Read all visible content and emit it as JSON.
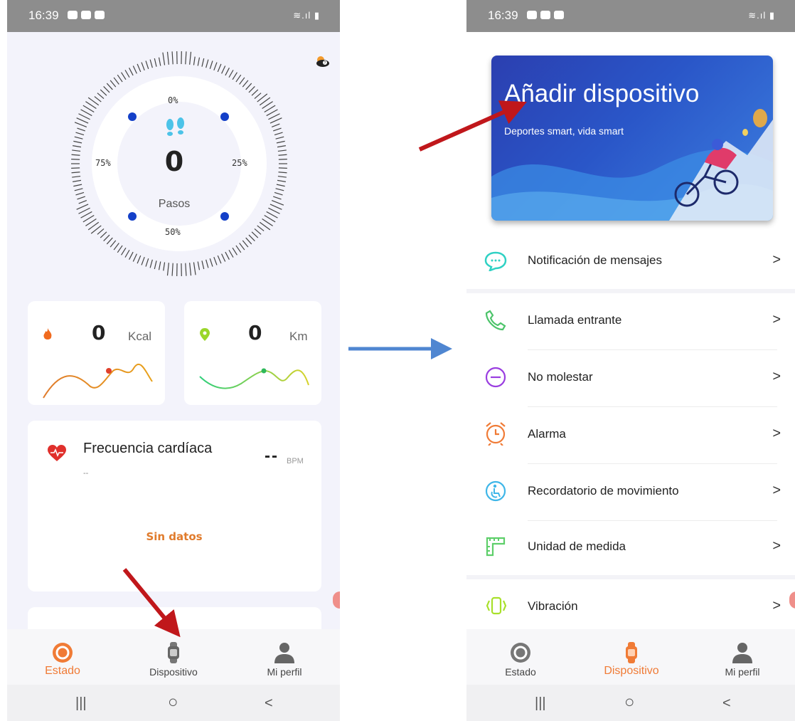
{
  "left_screen": {
    "status": {
      "time": "16:39"
    },
    "steps": {
      "value": "0",
      "label": "Pasos",
      "p0": "0%",
      "p25": "25%",
      "p50": "50%",
      "p75": "75%"
    },
    "calories": {
      "value": "0",
      "unit": "Kcal"
    },
    "distance": {
      "value": "0",
      "unit": "Km"
    },
    "heart_rate": {
      "title": "Frecuencia cardíaca",
      "subtitle": "--",
      "value": "--",
      "unit": "BPM",
      "empty": "Sin datos"
    },
    "tabs": [
      {
        "label": "Estado",
        "icon": "circle-target-icon",
        "active": true
      },
      {
        "label": "Dispositivo",
        "icon": "watch-icon",
        "active": false
      },
      {
        "label": "Mi perfil",
        "icon": "person-icon",
        "active": false
      }
    ],
    "nav": {
      "recents": "|||",
      "home": "○",
      "back": "<"
    }
  },
  "right_screen": {
    "status": {
      "time": "16:39"
    },
    "banner": {
      "title": "Añadir dispositivo",
      "subtitle": "Deportes smart, vida smart"
    },
    "menu": [
      {
        "label": "Notificación de mensajes",
        "icon": "message-bubble-icon"
      },
      {
        "label": "Llamada entrante",
        "icon": "phone-icon"
      },
      {
        "label": "No molestar",
        "icon": "minus-circle-icon"
      },
      {
        "label": "Alarma",
        "icon": "alarm-clock-icon"
      },
      {
        "label": "Recordatorio de movimiento",
        "icon": "accessibility-icon"
      },
      {
        "label": "Unidad de medida",
        "icon": "ruler-icon"
      },
      {
        "label": "Vibración",
        "icon": "vibration-icon"
      }
    ],
    "chevron": ">",
    "tabs": [
      {
        "label": "Estado",
        "icon": "circle-target-icon",
        "active": false
      },
      {
        "label": "Dispositivo",
        "icon": "watch-icon",
        "active": true
      },
      {
        "label": "Mi perfil",
        "icon": "person-icon",
        "active": false
      }
    ],
    "nav": {
      "recents": "|||",
      "home": "○",
      "back": "<"
    }
  },
  "colors": {
    "accent": "#f07b36",
    "arrow_red": "#c0171b",
    "arrow_blue": "#4f86d1"
  }
}
